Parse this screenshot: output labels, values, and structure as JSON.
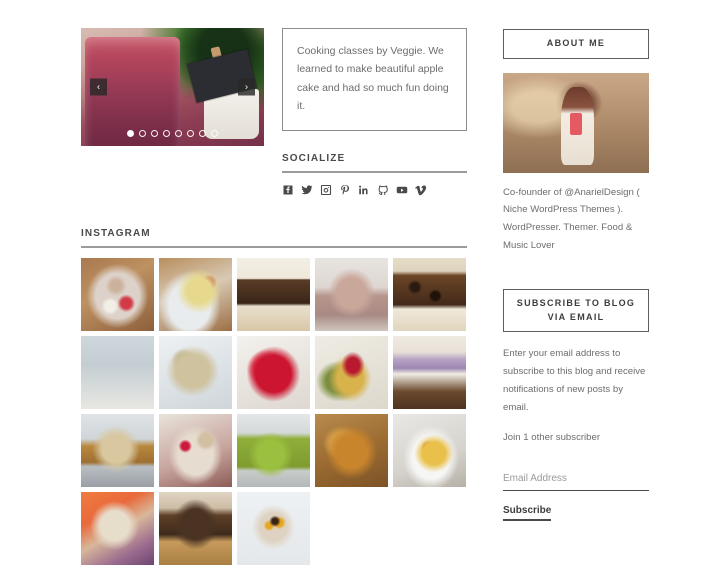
{
  "slider": {
    "prev_label": "‹",
    "next_label": "›",
    "dot_count": 8,
    "active_dot": 0
  },
  "quote": {
    "text": "Cooking classes by Veggie. We learned to make beautiful apple cake and had so much fun doing it."
  },
  "socialize": {
    "title": "SOCIALIZE",
    "icons": [
      {
        "name": "facebook-icon",
        "label": "Facebook"
      },
      {
        "name": "twitter-icon",
        "label": "Twitter"
      },
      {
        "name": "instagram-icon",
        "label": "Instagram"
      },
      {
        "name": "pinterest-icon",
        "label": "Pinterest"
      },
      {
        "name": "linkedin-icon",
        "label": "LinkedIn"
      },
      {
        "name": "github-icon",
        "label": "GitHub"
      },
      {
        "name": "youtube-icon",
        "label": "YouTube"
      },
      {
        "name": "vimeo-icon",
        "label": "Vimeo"
      }
    ]
  },
  "instagram": {
    "title": "INSTAGRAM",
    "photos": [
      {
        "alt": "Coconut porridge bowl with banana and raspberry"
      },
      {
        "alt": "Pasta salad in a white bowl"
      },
      {
        "alt": "Slice of dark chocolate cake on oats"
      },
      {
        "alt": "Smoothie in a glass jar with straw"
      },
      {
        "alt": "Slice of date and nut cake"
      },
      {
        "alt": "Green juice bottle with snacks on a plate"
      },
      {
        "alt": "Teddy bear shaped bread rolls"
      },
      {
        "alt": "Red beet salad on a white plate"
      },
      {
        "alt": "Vegetable noodles with pomegranate"
      },
      {
        "alt": "Slice of purple blueberry cheesecake"
      },
      {
        "alt": "Savoury muffins on a tray"
      },
      {
        "alt": "Coconut cream cake with nuts and a rose"
      },
      {
        "alt": "Green juice bottle on a counter"
      },
      {
        "alt": "Sweet potato noodles dish"
      },
      {
        "alt": "Pasta with vegetables in a white bowl"
      },
      {
        "alt": "Seeded cracker on an orange plate"
      },
      {
        "alt": "Wooden bowl of seeded crackers"
      },
      {
        "alt": "Porridge bowl with mango and berries"
      }
    ]
  },
  "sidebar": {
    "about": {
      "title": "ABOUT ME",
      "photo_alt": "Portrait of the author wearing sunglasses outdoors",
      "bio": "Co-founder of @AnarielDesign ( Niche WordPress Themes ). WordPresser. Themer. Food & Music Lover"
    },
    "subscribe": {
      "title": "SUBSCRIBE TO BLOG VIA EMAIL",
      "description": "Enter your email address to subscribe to this blog and receive notifications of new posts by email.",
      "subscriber_count": "Join 1 other subscriber",
      "email_placeholder": "Email Address",
      "email_value": "",
      "button_label": "Subscribe"
    }
  },
  "colors": {
    "text": "#6d6d6d",
    "heading": "#3d3d3d",
    "rule": "#9b9b9b",
    "border": "#5e5e5e",
    "background": "#ffffff"
  }
}
